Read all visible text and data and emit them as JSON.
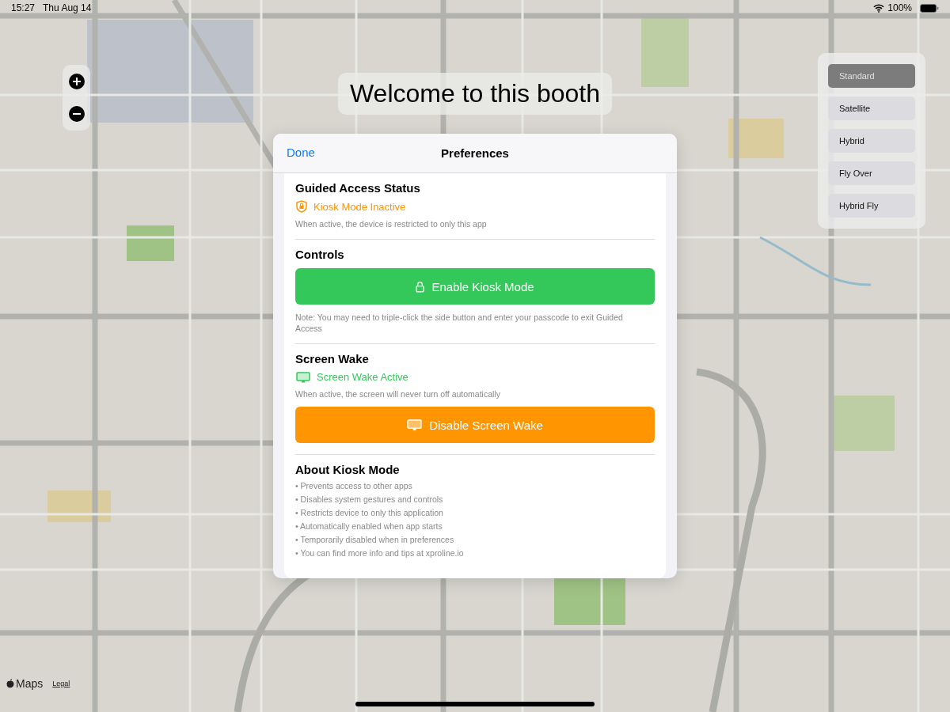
{
  "status_bar": {
    "time": "15:27",
    "date": "Thu Aug 14",
    "battery": "100%"
  },
  "banner": {
    "title": "Welcome to this booth"
  },
  "map_types": [
    {
      "label": "Standard",
      "selected": true
    },
    {
      "label": "Satellite",
      "selected": false
    },
    {
      "label": "Hybrid",
      "selected": false
    },
    {
      "label": "Fly Over",
      "selected": false
    },
    {
      "label": "Hybrid Fly",
      "selected": false
    }
  ],
  "attribution": {
    "brand": "Maps",
    "legal": "Legal"
  },
  "dialog": {
    "done": "Done",
    "title": "Preferences",
    "sections": [
      {
        "kind": "status",
        "heading": "Guided Access Status",
        "status": {
          "text": "Kiosk Mode Inactive",
          "color": "#ff9500"
        },
        "note": "When active, the device is restricted to only this app"
      },
      {
        "kind": "controls",
        "heading": "Controls",
        "button": {
          "label": "Enable Kiosk Mode",
          "color": "#34c759"
        },
        "note": "Note: You may need to triple-click the side button and enter your passcode to exit Guided Access"
      },
      {
        "kind": "wake",
        "heading": "Screen Wake",
        "status": {
          "text": "Screen Wake Active",
          "color": "#34c759"
        },
        "note": "When active, the screen will never turn off automatically",
        "button": {
          "label": "Disable Screen Wake",
          "color": "#ff9500"
        }
      },
      {
        "kind": "about",
        "heading": "About Kiosk Mode",
        "items": [
          "• Prevents access to other apps",
          "• Disables system gestures and controls",
          "• Restricts device to only this application",
          "• Automatically enabled when app starts",
          "• Temporarily disabled when in preferences",
          "• You can find more info and tips at xproline.io"
        ]
      }
    ]
  }
}
